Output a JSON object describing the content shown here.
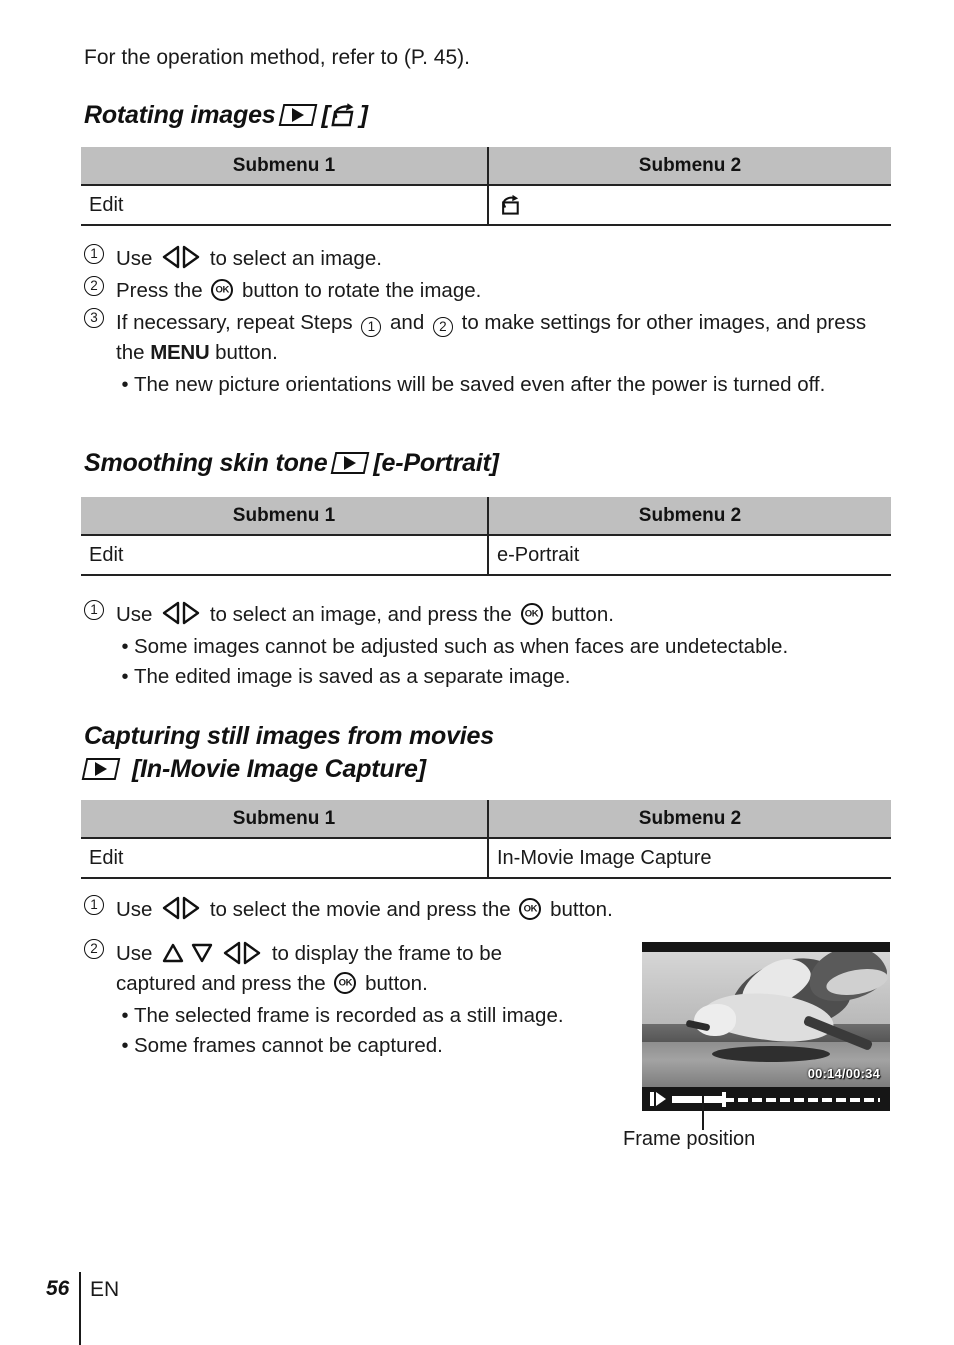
{
  "intro": {
    "text": "For the operation method, refer to (P. 45)."
  },
  "sections": [
    {
      "id": "rotating-images",
      "heading_text": "Rotating images",
      "heading_icons": [
        "playback-icon",
        "bracket-open",
        "rotate-icon",
        "bracket-close"
      ],
      "table": {
        "headers": [
          "Submenu 1",
          "Submenu 2"
        ],
        "rows": [
          {
            "submenu1": "Edit",
            "submenu2": "",
            "submenu2_icon": "rotate-icon"
          }
        ]
      },
      "steps": [
        {
          "num": "1",
          "pre": "Use ",
          "icon": "left-right-arrows",
          "post": " to select an image."
        },
        {
          "num": "2",
          "pre": "Press the ",
          "icon": "ok-button",
          "post": " button to rotate the image."
        },
        {
          "num": "3",
          "pre": "If necessary, repeat Steps ",
          "post": " to make settings for other images, and press the MENU button.",
          "bullets": [
            "The new picture orientations will be saved even after the power is turned off."
          ]
        }
      ]
    },
    {
      "id": "smoothing-skin-tone",
      "heading_text": "Smoothing skin tone",
      "heading_suffix": "[e-Portrait]",
      "table": {
        "headers": [
          "Submenu 1",
          "Submenu 2"
        ],
        "rows": [
          {
            "submenu1": "Edit",
            "submenu2": "e-Portrait"
          }
        ]
      },
      "steps": [
        {
          "num": "1",
          "pre": "Use ",
          "post": " to select an image, and press the ",
          "tail": " button."
        }
      ],
      "bullets": [
        "Some images cannot be adjusted such as when faces are undetectable.",
        "The edited image is saved as a separate image."
      ]
    },
    {
      "id": "in-movie-image-capture",
      "heading_line1": "Capturing still images from movies",
      "heading_line2_suffix": "[In-Movie Image Capture]",
      "table": {
        "headers": [
          "Submenu 1",
          "Submenu 2"
        ],
        "rows": [
          {
            "submenu1": "Edit",
            "submenu2": "In-Movie Image Capture"
          }
        ]
      },
      "steps": [
        {
          "num": "1",
          "pre": "Use ",
          "post": " to select the movie and press the ",
          "tail": " button."
        },
        {
          "num": "2",
          "pre": "Use ",
          "post": " to display the frame to be captured and press the ",
          "tail": " button.",
          "bullets": [
            "The selected frame is recorded as a still image.",
            "Some frames cannot be captured."
          ]
        }
      ]
    }
  ],
  "step_text": {
    "s1_use": "Use ",
    "s1_select_image": " to select an image.",
    "s2_press_the": "Press the ",
    "s2_rotate": " button to rotate the image.",
    "s3_repeat_pre": "If necessary, repeat Steps ",
    "s3_and": " and ",
    "s3_post": " to make settings for other images, and press the ",
    "s3_menu": "MENU",
    "s3_button": " button.",
    "s3_bullet": "The new picture orientations will be saved even after the power is turned off.",
    "ep_use": "Use ",
    "ep_mid": " to select an image, and press the ",
    "ep_tail": " button.",
    "ep_b1": "Some images cannot be adjusted such as when faces are undetectable.",
    "ep_b2": "The edited image is saved as a separate image.",
    "mv1_use": "Use ",
    "mv1_mid": " to select the movie and press the ",
    "mv1_tail": " button.",
    "mv2_use": "Use ",
    "mv2_mid": " to display the frame to be captured and press the ",
    "mv2_tail": " button.",
    "mv2_b1": "The selected frame is recorded as a still image.",
    "mv2_b2": "Some frames cannot be captured."
  },
  "step_numbers": {
    "one": "1",
    "two": "2",
    "three": "3"
  },
  "ok_label": "OK",
  "brackets": {
    "open": "[",
    "close": "]"
  },
  "lcd": {
    "timecode": "00:14/00:34",
    "elapsed": "00:14",
    "total": "00:34",
    "progress_percent": 25,
    "caption": "Frame position",
    "play_icon": "pause-play-icon"
  },
  "footer": {
    "page_number": "56",
    "language": "EN"
  },
  "colors": {
    "table_header_bg": "#bfbfbf",
    "rule": "#222222",
    "text": "#1a1a1a",
    "lcd_bg": "#161616"
  }
}
